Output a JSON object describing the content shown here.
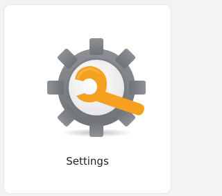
{
  "tile": {
    "label": "Settings",
    "icon": "settings-gear-wrench-icon"
  },
  "colors": {
    "page_bg": "#f3f3f3",
    "card_bg": "#ffffff",
    "gear": "#77797d",
    "gear_highlight": "#8d9094",
    "gear_center": "#f4f4f4",
    "wrench": "#f5a01e",
    "text": "#222222"
  }
}
